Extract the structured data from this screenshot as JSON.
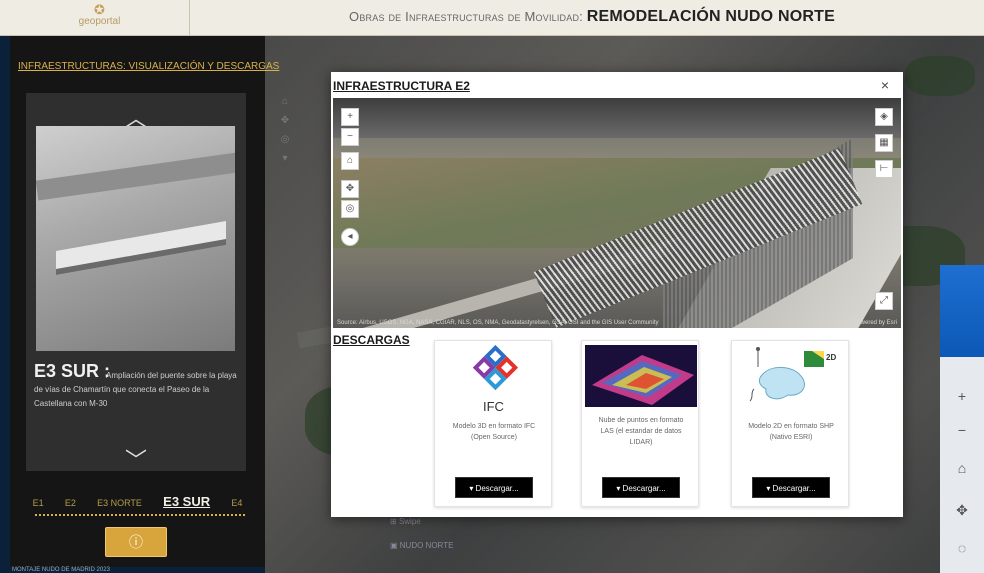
{
  "header": {
    "logo_mark": "✪",
    "logo_text": "geoportal",
    "title_prefix": "Obras de Infraestructuras de Movilidad:",
    "title_main": "REMODELACIÓN NUDO NORTE"
  },
  "left_panel": {
    "link": "INFRAESTRUCTURAS: VISUALIZACIÓN Y DESCARGAS",
    "item_name": "E3 SUR :",
    "item_description": "Ampliación del puente sobre la playa de vías de Chamartín que conecta el Paseo de la Castellana con M-30",
    "tabs": [
      "E1",
      "E2",
      "E3 NORTE",
      "E3 SUR",
      "E4"
    ],
    "active_tab": "E3 SUR",
    "info_button": "ⓘ",
    "up_arrow": "︿",
    "down_arrow": "﹀"
  },
  "footer_note": "MONTAJE NUDO DE MADRID 2023",
  "modal": {
    "title": "INFRAESTRUCTURA E2",
    "close": "×",
    "scene_attribution": "Source: Airbus, USGS, NGA, NASA, CGIAR, NLS, OS, NMA, Geodatastyrelsen, GSA, GSI and the GIS User Community",
    "scene_powered": "Powered by Esri",
    "downloads_title": "DESCARGAS",
    "downloads": [
      {
        "icon": "ifc-logo-icon",
        "icon_label": "IFC",
        "description": "Modelo 3D en formato IFC (Open Source)",
        "button": "▾ Descargar..."
      },
      {
        "icon": "point-cloud-icon",
        "description": "Nube de puntos en formato LAS (el estandar de datos LIDAR)",
        "button": "▾ Descargar..."
      },
      {
        "icon": "shp-2d-icon",
        "icon_label": "2D",
        "description": "Modelo 2D en formato SHP (Nativo ESRI)",
        "button": "▾ Descargar..."
      }
    ]
  },
  "map_hints": {
    "swipe": "Swipe",
    "nudo": "NUDO NORTE"
  },
  "colors": {
    "accent_gold": "#d8a43c",
    "header_bg": "#efece3",
    "panel_bg": "#151515",
    "blue": "#1e6fd1"
  }
}
